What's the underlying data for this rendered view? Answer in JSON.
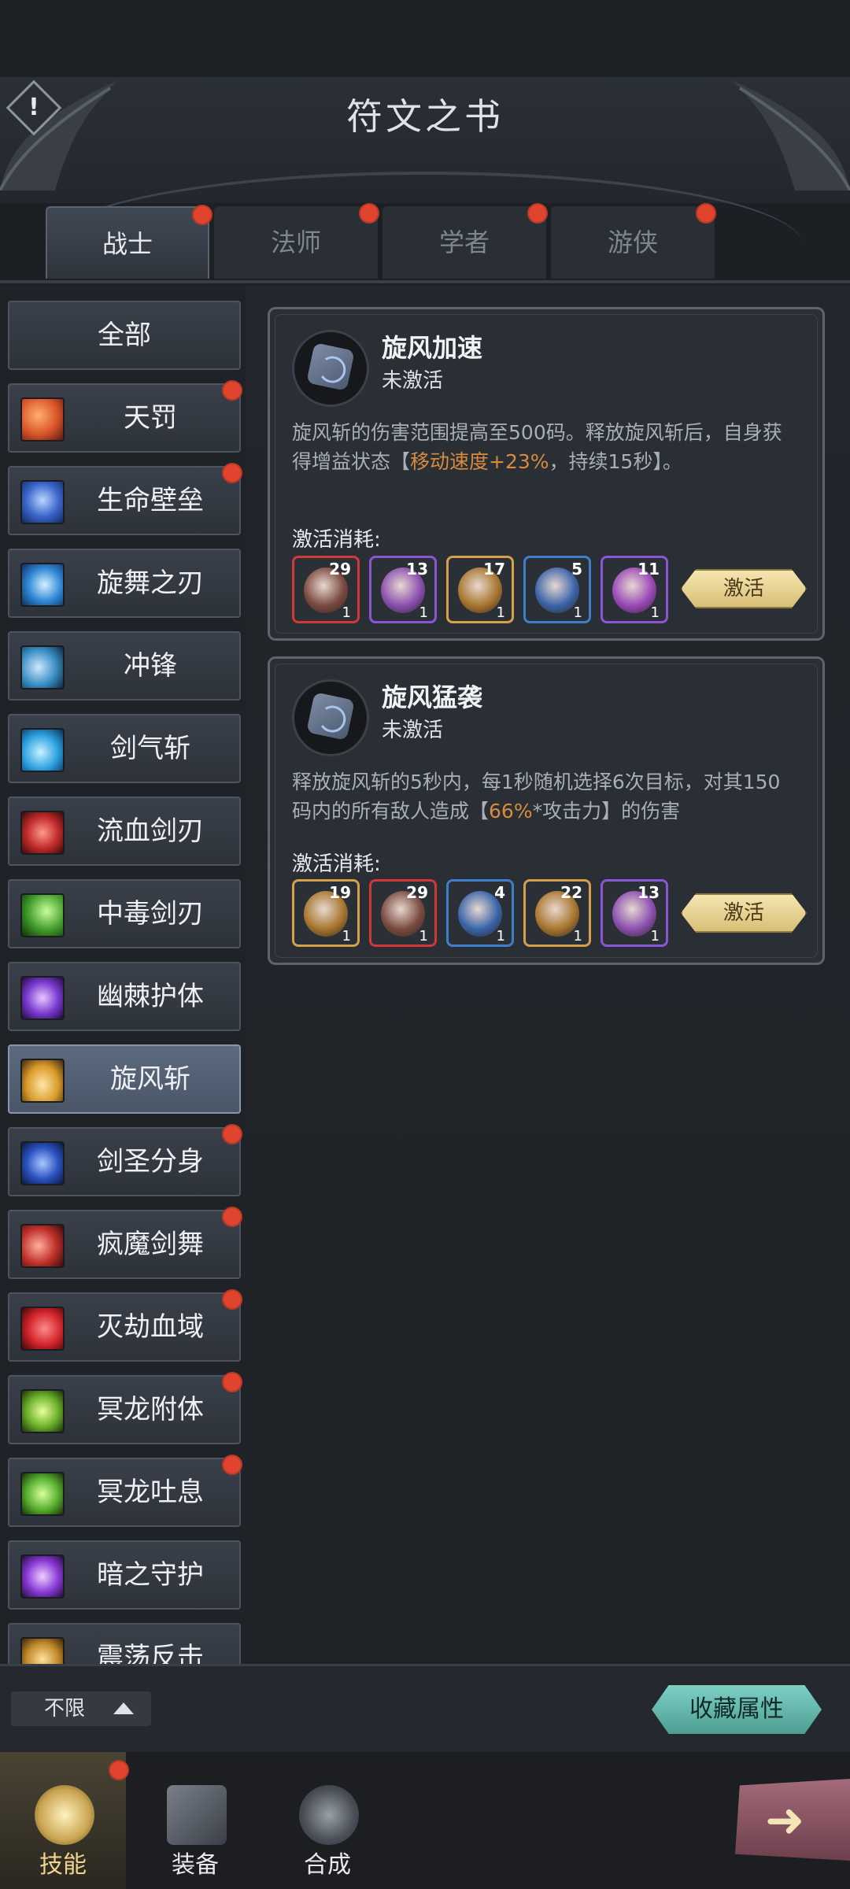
{
  "header": {
    "title": "符文之书",
    "alert_symbol": "!"
  },
  "tabs": [
    {
      "label": "战士",
      "active": true,
      "badge": true
    },
    {
      "label": "法师",
      "active": false,
      "badge": true
    },
    {
      "label": "学者",
      "active": false,
      "badge": true
    },
    {
      "label": "游侠",
      "active": false,
      "badge": true
    }
  ],
  "sidebar": {
    "items": [
      {
        "label": "全部",
        "badge": false
      },
      {
        "label": "天罚",
        "badge": true,
        "icon": "heaven-punish-icon",
        "color": "#d9542a"
      },
      {
        "label": "生命壁垒",
        "badge": true,
        "icon": "life-barrier-icon",
        "color": "#3a64c9"
      },
      {
        "label": "旋舞之刃",
        "badge": false,
        "icon": "whirl-blade-icon",
        "color": "#2f86d6"
      },
      {
        "label": "冲锋",
        "badge": false,
        "icon": "charge-icon",
        "color": "#3a8fc4"
      },
      {
        "label": "剑气斩",
        "badge": false,
        "icon": "sword-qi-icon",
        "color": "#2aa0e0"
      },
      {
        "label": "流血剑刃",
        "badge": false,
        "icon": "bleed-blade-icon",
        "color": "#c02a2a"
      },
      {
        "label": "中毒剑刃",
        "badge": false,
        "icon": "poison-blade-icon",
        "color": "#3f9a2a"
      },
      {
        "label": "幽棘护体",
        "badge": false,
        "icon": "thorn-guard-icon",
        "color": "#7a3ad0"
      },
      {
        "label": "旋风斩",
        "badge": false,
        "active": true,
        "icon": "whirlwind-icon",
        "color": "#d99a2a"
      },
      {
        "label": "剑圣分身",
        "badge": true,
        "icon": "clone-icon",
        "color": "#2a52c0"
      },
      {
        "label": "疯魔剑舞",
        "badge": true,
        "icon": "frenzy-dance-icon",
        "color": "#c0302a"
      },
      {
        "label": "灭劫血域",
        "badge": true,
        "icon": "blood-domain-icon",
        "color": "#d0242a"
      },
      {
        "label": "冥龙附体",
        "badge": true,
        "icon": "dragon-possess-icon",
        "color": "#6ab02a"
      },
      {
        "label": "冥龙吐息",
        "badge": true,
        "icon": "dragon-breath-icon",
        "color": "#58b030"
      },
      {
        "label": "暗之守护",
        "badge": false,
        "icon": "dark-guard-icon",
        "color": "#8a3ad6"
      },
      {
        "label": "震荡反击",
        "badge": false,
        "icon": "shock-counter-icon",
        "color": "#c08a2a"
      }
    ]
  },
  "cards": [
    {
      "name": "旋风加速",
      "status": "未激活",
      "desc_pre": "旋风斩的伤害范围提高至500码。释放旋风斩后，自身获得增益状态【",
      "desc_hl": "移动速度+23%",
      "desc_post": "，持续15秒】。",
      "cost_label": "激活消耗:",
      "button": "激活",
      "runes": [
        {
          "num": "29",
          "cnt": "1",
          "border": "#d0393a",
          "gem": "#7a4a40"
        },
        {
          "num": "13",
          "cnt": "1",
          "border": "#8b55d6",
          "gem": "#8a4fb0"
        },
        {
          "num": "17",
          "cnt": "1",
          "border": "#d6a04a",
          "gem": "#a8762e"
        },
        {
          "num": "5",
          "cnt": "1",
          "border": "#3f7ec8",
          "gem": "#3a64a8"
        },
        {
          "num": "11",
          "cnt": "1",
          "border": "#8b55d6",
          "gem": "#9a48b8"
        }
      ]
    },
    {
      "name": "旋风猛袭",
      "status": "未激活",
      "desc_pre": "释放旋风斩的5秒内，每1秒随机选择6次目标，对其150码内的所有敌人造成【",
      "desc_hl": "66%",
      "desc_post": "*攻击力】的伤害",
      "cost_label": "激活消耗:",
      "button": "激活",
      "runes": [
        {
          "num": "19",
          "cnt": "1",
          "border": "#d6a04a",
          "gem": "#a8762e"
        },
        {
          "num": "29",
          "cnt": "1",
          "border": "#d0393a",
          "gem": "#7a4a40"
        },
        {
          "num": "4",
          "cnt": "1",
          "border": "#3f7ec8",
          "gem": "#3a64a8"
        },
        {
          "num": "22",
          "cnt": "1",
          "border": "#d6a04a",
          "gem": "#a8762e"
        },
        {
          "num": "13",
          "cnt": "1",
          "border": "#8b55d6",
          "gem": "#8a4fb0"
        }
      ]
    }
  ],
  "filter": {
    "label": "不限"
  },
  "collect_button": "收藏属性",
  "nav": [
    {
      "label": "技能",
      "active": true,
      "badge": true,
      "color": "#f0d48a"
    },
    {
      "label": "装备",
      "active": false,
      "badge": false,
      "color": "#e8eaee"
    },
    {
      "label": "合成",
      "active": false,
      "badge": false,
      "color": "#e8eaee"
    }
  ],
  "next_arrow": "➜"
}
